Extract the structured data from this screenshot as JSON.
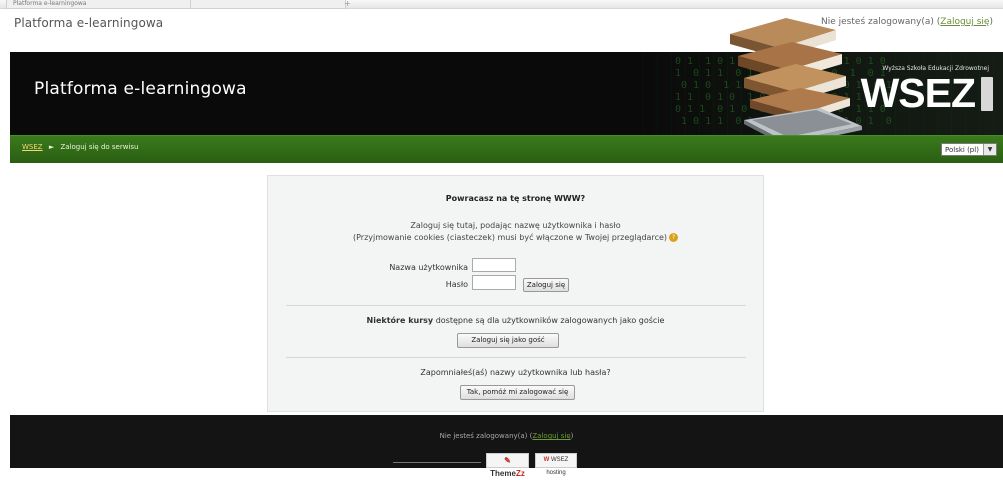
{
  "browser": {
    "tabs": [
      {
        "label": "Platforma e-learningowa"
      },
      {
        "label": ""
      }
    ],
    "new_tab": "+"
  },
  "top": {
    "site_title": "Platforma e-learningowa",
    "login_status_prefix": "Nie jesteś zalogowany(a)",
    "login_link": "Zaloguj się"
  },
  "header": {
    "title": "Platforma e-learningowa",
    "logo_text": "WSEZ",
    "logo_tagline": "Wyższa Szkoła Edukacji Zdrowotnej"
  },
  "nav": {
    "breadcrumb_home": "WSEZ",
    "breadcrumb_separator": "►",
    "breadcrumb_current": "Zaloguj się do serwisu",
    "language_selected": "Polski (pl)"
  },
  "login": {
    "heading": "Powracasz na tę stronę WWW?",
    "intro_line1": "Zaloguj się tutaj, podając nazwę użytkownika i hasło",
    "intro_line2": "(Przyjmowanie cookies (ciasteczek) musi być włączone w Twojej przeglądarce)",
    "help_icon": "?",
    "username_label": "Nazwa użytkownika",
    "password_label": "Hasło",
    "username_value": "",
    "password_value": "",
    "login_button": "Zaloguj się",
    "guest_text_bold": "Niektóre kursy",
    "guest_text": "dostępne są dla użytkowników zalogowanych jako goście",
    "guest_button": "Zaloguj się jako gość",
    "forgot_text": "Zapomniałeś(aś) nazwy użytkownika lub hasła?",
    "forgot_button": "Tak, pomóż mi zalogować się"
  },
  "footer": {
    "login_status_prefix": "Nie jesteś zalogowany(a)",
    "login_link": "Zaloguj się",
    "theme_logo_text": "Theme",
    "theme_logo_red": "Zz",
    "host_logo_red": "W",
    "host_logo_text": "WSEZ hosting"
  },
  "colors": {
    "header_bg": "#0a0a0a",
    "nav_green": "#2f6a15",
    "link_green": "#6f9b34",
    "footer_bg": "#141414",
    "login_box_bg": "#f3f4f4"
  }
}
